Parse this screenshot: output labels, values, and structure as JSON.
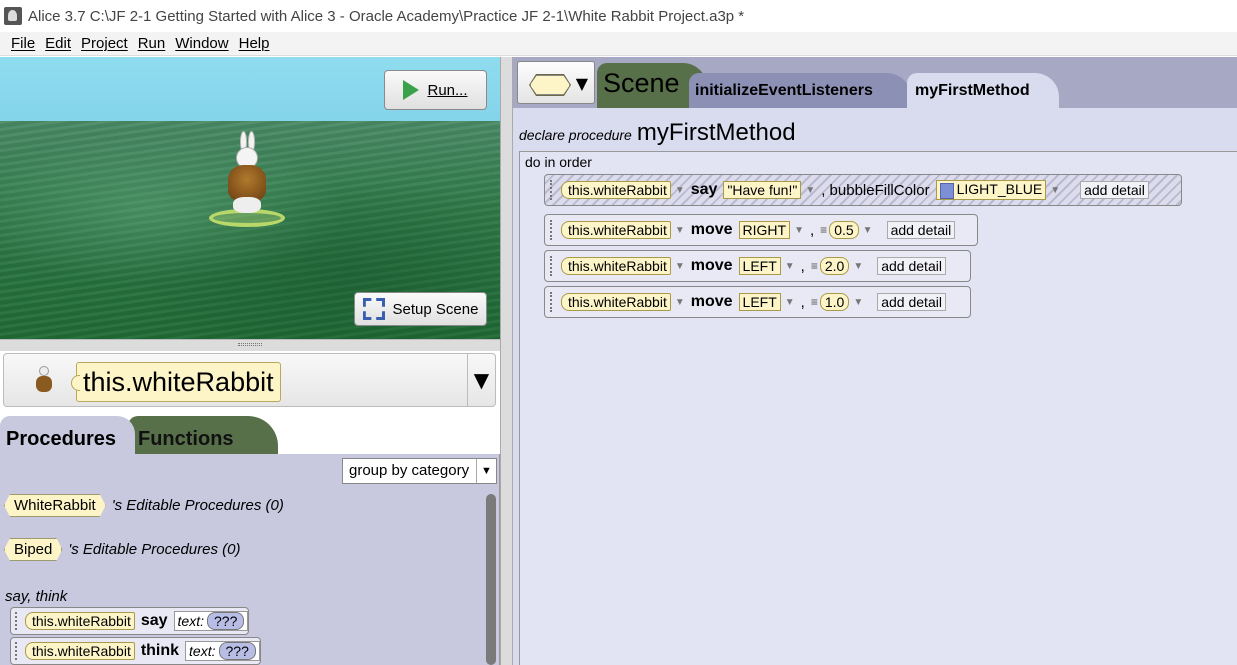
{
  "window": {
    "title": "Alice 3.7 C:\\JF 2-1 Getting Started with Alice 3  - Oracle Academy\\Practice JF 2-1\\White Rabbit Project.a3p *"
  },
  "menu": [
    "File",
    "Edit",
    "Project",
    "Run",
    "Window",
    "Help"
  ],
  "scene": {
    "run_label": "Run...",
    "setup_label": "Setup Scene"
  },
  "selector": {
    "object": "this.whiteRabbit",
    "dropdown": "▼"
  },
  "left_tabs": {
    "procedures": "Procedures",
    "functions": "Functions"
  },
  "palette": {
    "group_by": "group by category",
    "classes": [
      {
        "name": "WhiteRabbit",
        "suffix": "'s Editable Procedures (0)"
      },
      {
        "name": "Biped",
        "suffix": "'s Editable Procedures (0)"
      }
    ],
    "category": "say, think",
    "tiles": [
      {
        "object": "this.whiteRabbit",
        "keyword": "say",
        "param_label": "text:",
        "value": "???"
      },
      {
        "object": "this.whiteRabbit",
        "keyword": "think",
        "param_label": "text:",
        "value": "???"
      }
    ]
  },
  "editor": {
    "tabs": {
      "scene": "Scene",
      "init": "initializeEventListeners",
      "method": "myFirstMethod"
    },
    "declare_label": "declare procedure",
    "method_name": "myFirstMethod",
    "do_label": "do in order",
    "statements": [
      {
        "object": "this.whiteRabbit",
        "keyword": "say",
        "arg1": "\"Have fun!\"",
        "extra_label": ", bubbleFillColor",
        "arg2": "LIGHT_BLUE",
        "add": "add detail"
      },
      {
        "object": "this.whiteRabbit",
        "keyword": "move",
        "arg1": "RIGHT",
        "sep": ",",
        "arg2": "0.5",
        "add": "add detail"
      },
      {
        "object": "this.whiteRabbit",
        "keyword": "move",
        "arg1": "LEFT",
        "sep": ",",
        "arg2": "2.0",
        "add": "add detail"
      },
      {
        "object": "this.whiteRabbit",
        "keyword": "move",
        "arg1": "LEFT",
        "sep": ",",
        "arg2": "1.0",
        "add": "add detail"
      }
    ]
  },
  "colors": {
    "object_chip": "#fdf5c8",
    "palette_bg": "#c8c9df",
    "functions_tab": "#58704a",
    "sky": "#8fdcef",
    "grass": "#2f7a48"
  }
}
